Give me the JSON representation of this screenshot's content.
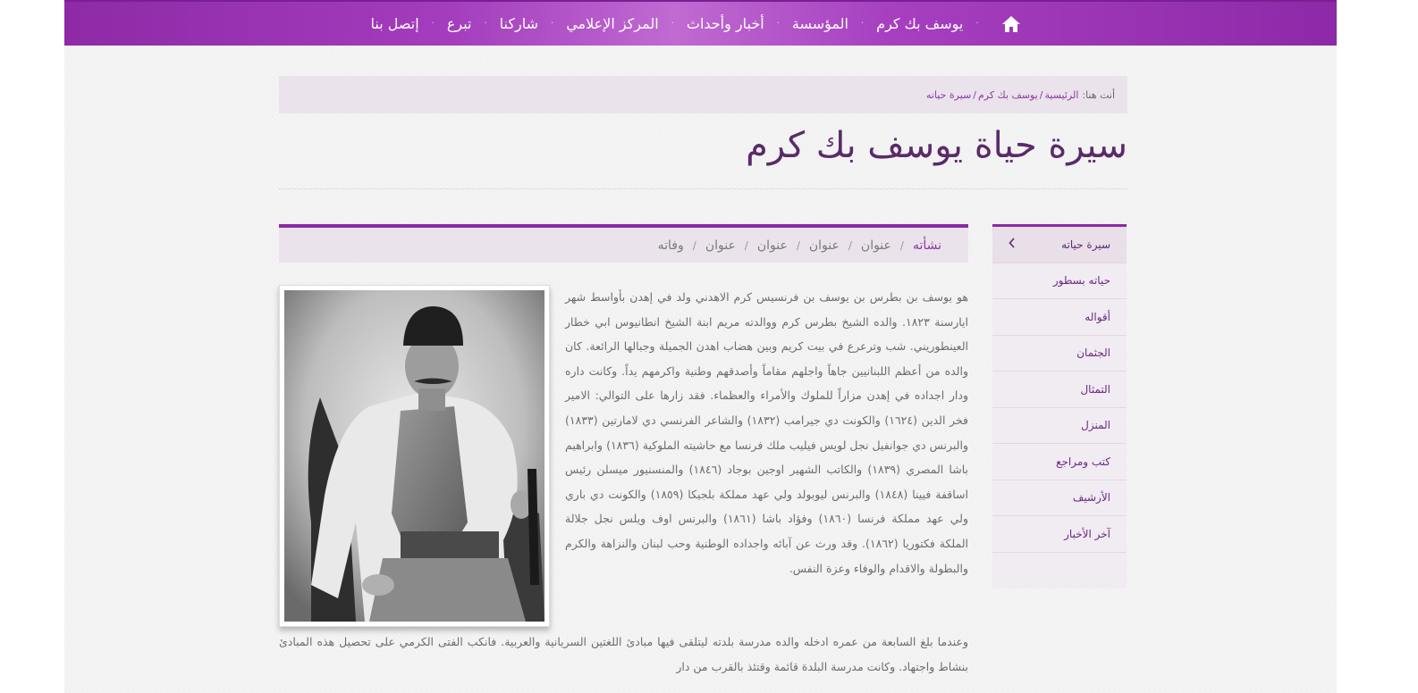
{
  "nav": {
    "items": [
      {
        "label": "يوسف بك كرم"
      },
      {
        "label": "المؤسسة"
      },
      {
        "label": "أخبار وأحداث"
      },
      {
        "label": "المركز الإعلامي"
      },
      {
        "label": "شاركنا"
      },
      {
        "label": "تبرع"
      },
      {
        "label": "إتصل بنا"
      }
    ],
    "separator": "·",
    "home_icon": "home-icon"
  },
  "breadcrumb": {
    "label": "أنت هنا:",
    "items": [
      "الرئيسية",
      "يوسف بك كرم",
      "سيرة حياته"
    ],
    "separator": "/"
  },
  "page": {
    "title": "سيرة حياة يوسف بك كرم"
  },
  "sidebar": {
    "items": [
      {
        "label": "سيرة حياته",
        "active": true
      },
      {
        "label": "حياته بسطور"
      },
      {
        "label": "أقواله"
      },
      {
        "label": "الجثمان"
      },
      {
        "label": "التمثال"
      },
      {
        "label": "المنزل"
      },
      {
        "label": "كتب ومراجع"
      },
      {
        "label": "الأرشيف"
      },
      {
        "label": "آخر الأخبار"
      }
    ],
    "active_chevron": "chevron-left-icon"
  },
  "tabs": {
    "items": [
      "نشأته",
      "عنوان",
      "عنوان",
      "عنوان",
      "عنوان",
      "وفاته"
    ],
    "active_index": 0,
    "separator": "/"
  },
  "article": {
    "paragraph_1": "هو يوسف بن بطرس بن يوسف بن فرنسيس كرم الاهدني ولد في إهدن بأواسط شهر ايارسنة ١٨٢٣. والده الشيخ بطرس كرم ووالدته مريم ابنة الشيخ انطانيوس ابي خطار العينطوريني. شب وترعرع في بيت كريم وبين هضاب اهدن الجميلة وجبالها الرائعة. كان والده من أعظم اللبنانيين جاهاً واجلهم مقاماً وأصدقهم وطنية واكرمهم يداً. وكانت داره ودار اجداده في إهدن مزاراً للملوك والأمراء والعظماء. فقد زارها على التوالي: الامير فخر الدين (١٦٢٤) والكونت دي جيرامب (١٨٣٢) والشاعر الفرنسي دي لامارتين (١٨٣٣) والبرنس دي جوانفيل نجل لويس فيليب ملك فرنسا مع حاشيته الملوكية (١٨٣٦) وابراهيم باشا المصري (١٨٣٩) والكاتب الشهير اوجين بوجاد (١٨٤٦) والمنسنيور ميسلن رئيس اساقفة فيينا (١٨٤٨) والبرنس ليوبولد ولي عهد مملكة بلجيكا (١٨٥٩) والكونت دي باري ولي عهد مملكة فرنسا (١٨٦٠) وفؤاد باشا (١٨٦١) والبرنس اوف ويلس نجل جلالة الملكة فكتوريا (١٨٦٢). وقد ورث عن آبائه واجداده الوطنية وحب لبنان والنزاهة والكرم والبطولة والاقدام والوفاء وعزة النفس.",
    "paragraph_2": "وعندما بلغ السابعة من عمره ادخله والده مدرسة بلدته ليتلقى فيها مبادئ اللغتين السريانية والعربية. فانكب الفتى الكرمي على تحصيل هذه المبادئ بنشاط واجتهاد. وكانت مدرسة البلدة قائمة وقتئذ بالقرب من دار"
  },
  "colors": {
    "brand_purple": "#8e2aa6",
    "accent_purple": "#8a3aa0",
    "title_color": "#5a2a6a"
  }
}
